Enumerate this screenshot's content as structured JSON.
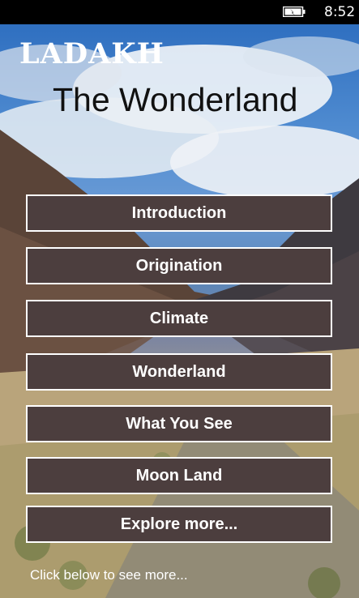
{
  "status_bar": {
    "time": "8:52",
    "battery_icon": "battery-charging-icon"
  },
  "header": {
    "brand": "LADAKH",
    "title": "The Wonderland"
  },
  "menu": {
    "items": [
      {
        "label": "Introduction"
      },
      {
        "label": "Origination"
      },
      {
        "label": "Climate"
      },
      {
        "label": "Wonderland"
      },
      {
        "label": "What You See"
      },
      {
        "label": "Moon Land"
      },
      {
        "label": "Explore more..."
      }
    ]
  },
  "footer": {
    "note": "Click below to see more..."
  },
  "colors": {
    "button_bg": "#4c3e3e",
    "button_border": "#ffffff",
    "status_bg": "#000000"
  }
}
